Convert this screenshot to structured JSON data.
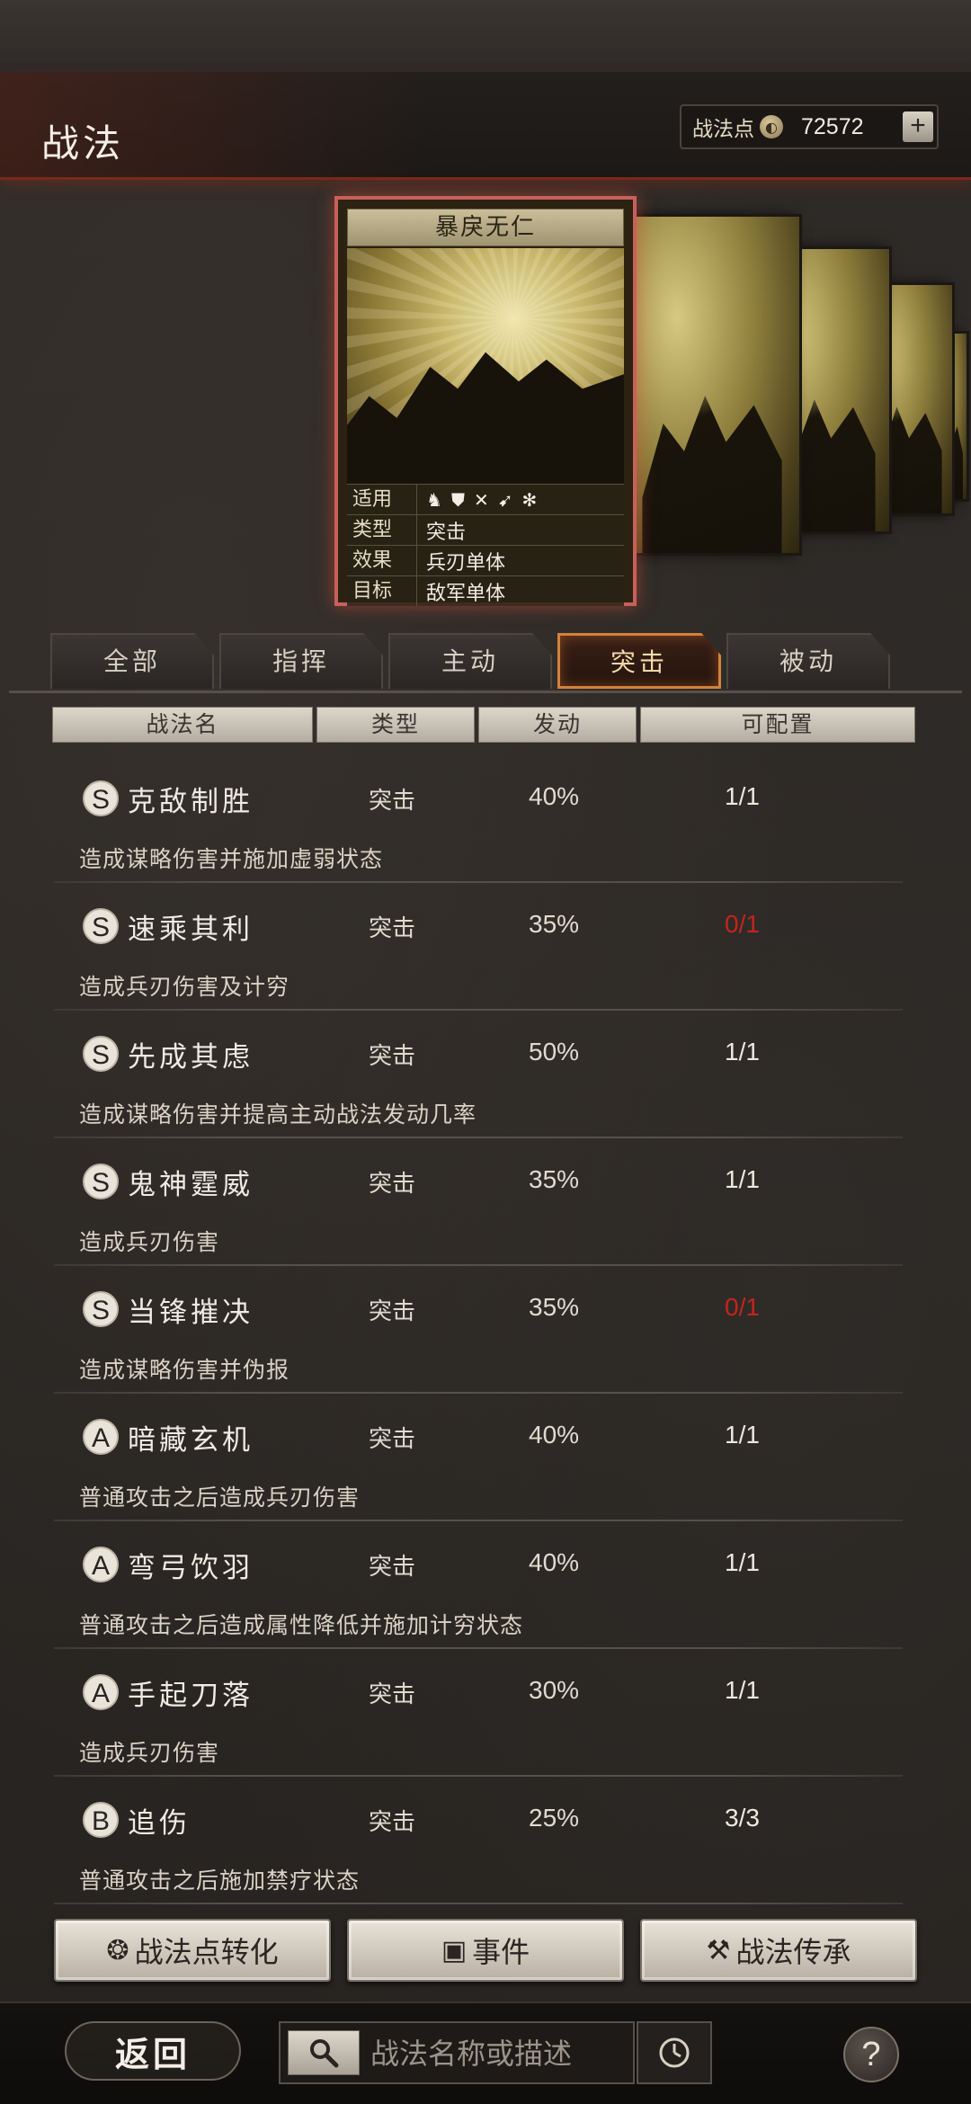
{
  "header": {
    "title": "战法",
    "points_label": "战法点",
    "points_value": "72572",
    "plus": "+"
  },
  "card": {
    "name": "暴戾无仁",
    "rows": [
      {
        "key": "适用",
        "value": ""
      },
      {
        "key": "类型",
        "value": "突击"
      },
      {
        "key": "效果",
        "value": "兵刃单体"
      },
      {
        "key": "目标",
        "value": "敌军单体"
      }
    ]
  },
  "tabs": [
    "全部",
    "指挥",
    "主动",
    "突击",
    "被动"
  ],
  "active_tab": "突击",
  "columns": [
    "战法名",
    "类型",
    "发动",
    "可配置"
  ],
  "skills": [
    {
      "grade": "S",
      "name": "克敌制胜",
      "type": "突击",
      "rate": "40%",
      "slot": "1/1",
      "desc": "造成谋略伤害并施加虚弱状态"
    },
    {
      "grade": "S",
      "name": "速乘其利",
      "type": "突击",
      "rate": "35%",
      "slot": "0/1",
      "desc": "造成兵刃伤害及计穷"
    },
    {
      "grade": "S",
      "name": "先成其虑",
      "type": "突击",
      "rate": "50%",
      "slot": "1/1",
      "desc": "造成谋略伤害并提高主动战法发动几率"
    },
    {
      "grade": "S",
      "name": "鬼神霆威",
      "type": "突击",
      "rate": "35%",
      "slot": "1/1",
      "desc": "造成兵刃伤害"
    },
    {
      "grade": "S",
      "name": "当锋摧决",
      "type": "突击",
      "rate": "35%",
      "slot": "0/1",
      "desc": "造成谋略伤害并伪报"
    },
    {
      "grade": "A",
      "name": "暗藏玄机",
      "type": "突击",
      "rate": "40%",
      "slot": "1/1",
      "desc": "普通攻击之后造成兵刃伤害"
    },
    {
      "grade": "A",
      "name": "弯弓饮羽",
      "type": "突击",
      "rate": "40%",
      "slot": "1/1",
      "desc": "普通攻击之后造成属性降低并施加计穷状态"
    },
    {
      "grade": "A",
      "name": "手起刀落",
      "type": "突击",
      "rate": "30%",
      "slot": "1/1",
      "desc": "造成兵刃伤害"
    },
    {
      "grade": "B",
      "name": "追伤",
      "type": "突击",
      "rate": "25%",
      "slot": "3/3",
      "desc": "普通攻击之后施加禁疗状态"
    }
  ],
  "actions": {
    "convert": "战法点转化",
    "event": "事件",
    "inherit": "战法传承"
  },
  "bottom": {
    "back": "返回",
    "search_placeholder": "战法名称或描述",
    "help": "?"
  },
  "colors": {
    "accent_orange": "#d2823c",
    "full_slot_red": "#c4241e",
    "card_border": "#c8605a"
  }
}
